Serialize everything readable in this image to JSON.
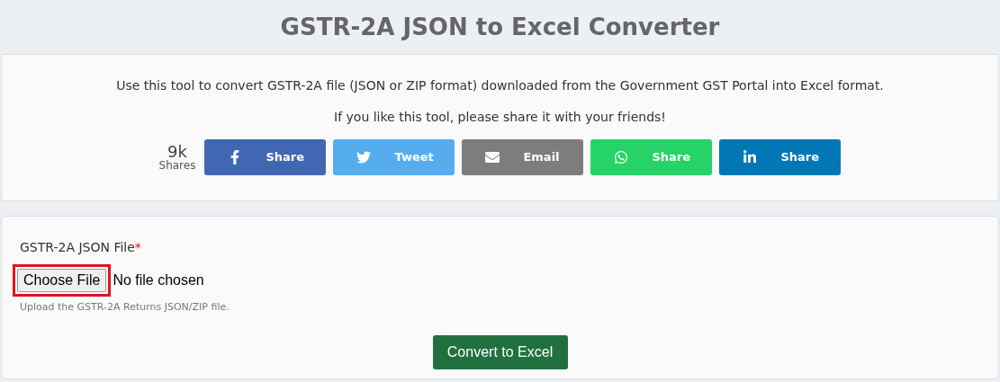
{
  "title": "GSTR-2A JSON to Excel Converter",
  "intro": {
    "description": "Use this tool to convert GSTR-2A file (JSON or ZIP format) downloaded from the Government GST Portal into Excel format.",
    "share_prompt": "If you like this tool, please share it with your friends!",
    "share_count": "9k",
    "share_count_label": "Shares",
    "share_buttons": [
      {
        "kind": "facebook",
        "label": "Share",
        "color": "#4267b2"
      },
      {
        "kind": "twitter",
        "label": "Tweet",
        "color": "#55acee"
      },
      {
        "kind": "email",
        "label": "Email",
        "color": "#7d7d7d"
      },
      {
        "kind": "whatsapp",
        "label": "Share",
        "color": "#25d366"
      },
      {
        "kind": "linkedin",
        "label": "Share",
        "color": "#0077b5"
      }
    ]
  },
  "form": {
    "field_label": "GSTR-2A JSON File",
    "required_mark": "*",
    "file_button": "Choose File",
    "file_button_highlighted": true,
    "file_status": "No file chosen",
    "help_text": "Upload the GSTR-2A Returns JSON/ZIP file.",
    "submit": "Convert to Excel"
  }
}
